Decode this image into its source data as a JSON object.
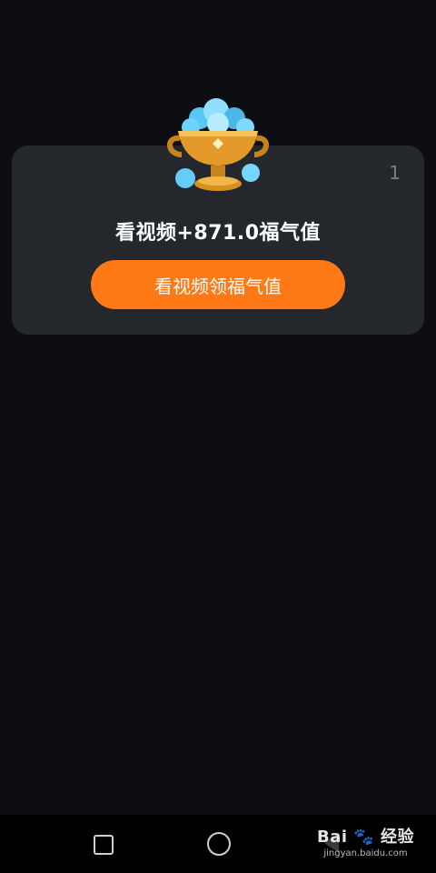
{
  "card": {
    "counter": "1",
    "reward_text": "看视频+871.0福气值",
    "button_label": "看视频领福气值"
  },
  "colors": {
    "background": "#0c0e11",
    "card": "#24282c",
    "accent": "#ff7a16"
  },
  "icons": {
    "trophy": "gem-trophy-icon",
    "nav_recent": "square-icon",
    "nav_home": "circle-icon",
    "nav_back": "triangle-back-icon"
  },
  "watermark": {
    "brand_left": "Bai",
    "brand_right": "经验",
    "url": "jingyan.baidu.com"
  }
}
